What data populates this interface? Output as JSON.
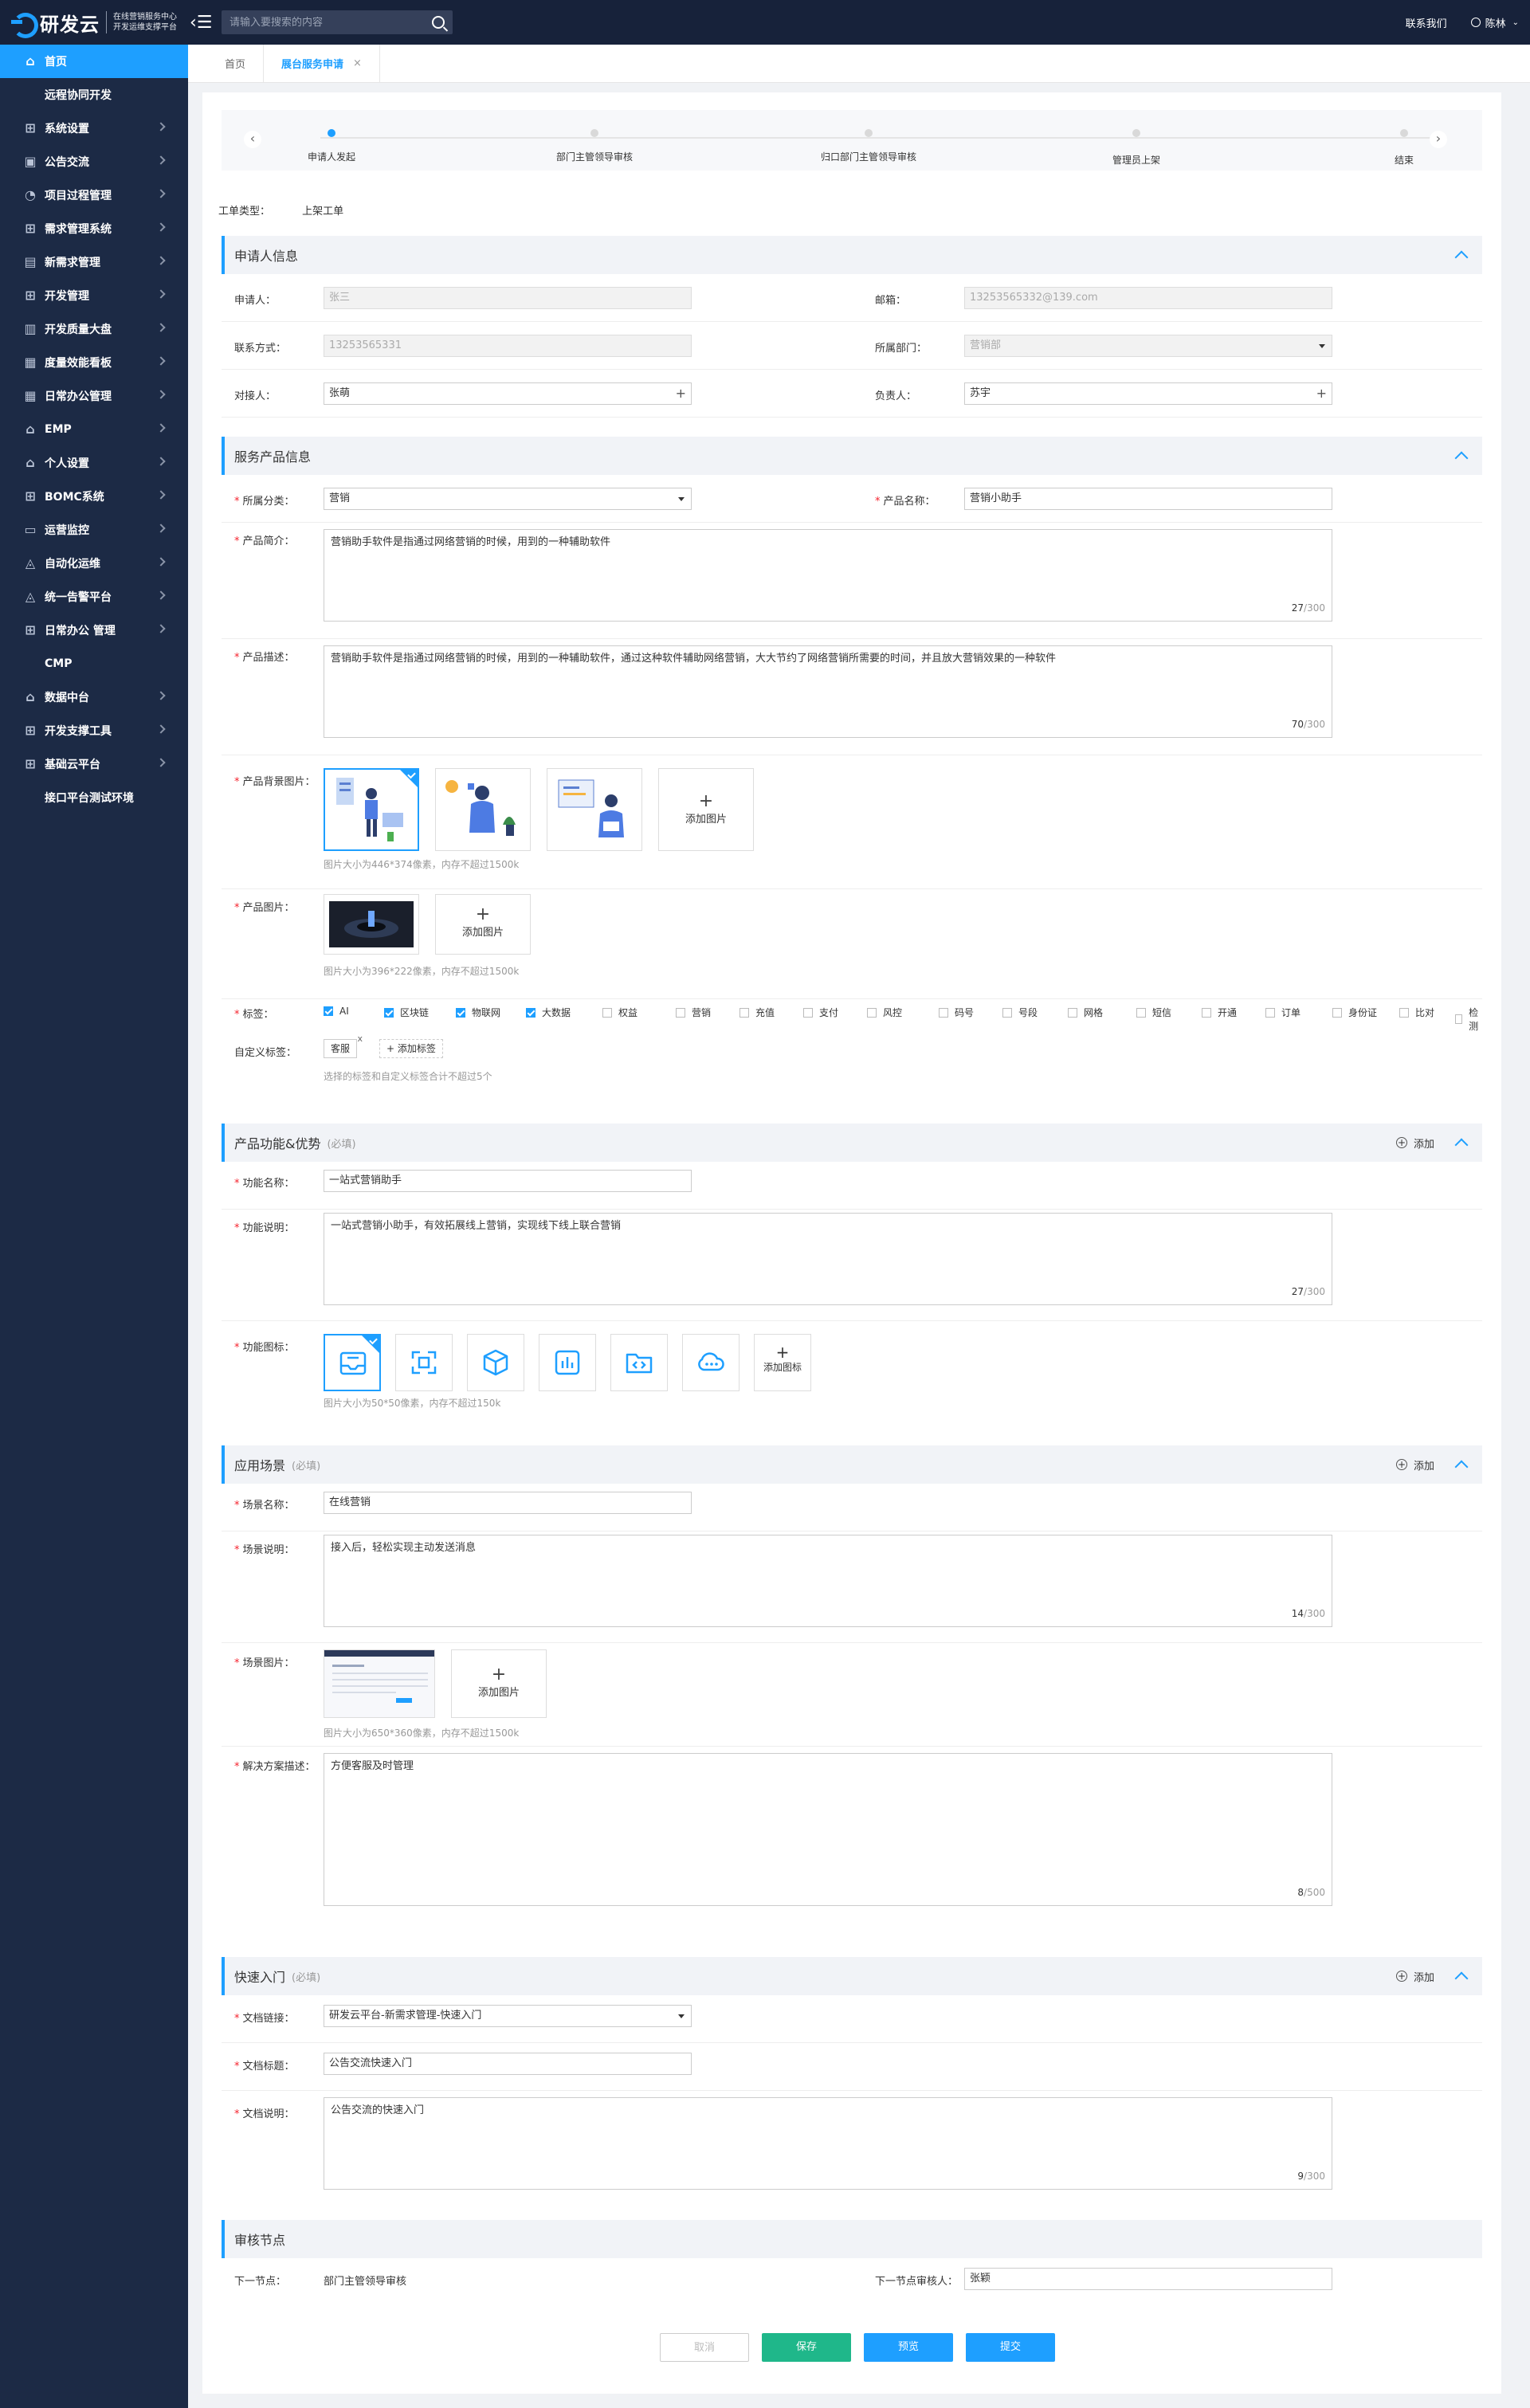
{
  "header": {
    "logo_name": "研发云",
    "logo_sub1": "在线营销服务中心",
    "logo_sub2": "开发运维支撑平台",
    "search_placeholder": "请输入要搜索的内容",
    "contact": "联系我们",
    "user": "陈林"
  },
  "sidebar": {
    "items": [
      {
        "label": "首页",
        "icon": "home-icon",
        "active": true
      },
      {
        "label": "远程协同开发",
        "child": true
      },
      {
        "label": "系统设置",
        "icon": "sitemap-icon"
      },
      {
        "label": "公告交流",
        "icon": "notice-icon"
      },
      {
        "label": "项目过程管理",
        "icon": "pie-icon"
      },
      {
        "label": "需求管理系统",
        "icon": "sitemap-icon"
      },
      {
        "label": "新需求管理",
        "icon": "requirement-icon"
      },
      {
        "label": "开发管理",
        "icon": "sitemap-icon"
      },
      {
        "label": "开发质量大盘",
        "icon": "bar-chart-icon"
      },
      {
        "label": "度量效能看板",
        "icon": "board-icon"
      },
      {
        "label": "日常办公管理",
        "icon": "calendar-icon"
      },
      {
        "label": "EMP",
        "icon": "home-icon"
      },
      {
        "label": "个人设置",
        "icon": "home-icon"
      },
      {
        "label": "BOMC系统",
        "icon": "sitemap-icon"
      },
      {
        "label": "运营监控",
        "icon": "monitor-icon"
      },
      {
        "label": "自动化运维",
        "icon": "bell-icon"
      },
      {
        "label": "统一告警平台",
        "icon": "bell-icon"
      },
      {
        "label": "日常办公 管理",
        "icon": "sitemap-icon"
      },
      {
        "label": "CMP",
        "child": true
      },
      {
        "label": "数据中台",
        "icon": "home-icon"
      },
      {
        "label": "开发支撑工具",
        "icon": "sitemap-icon"
      },
      {
        "label": "基础云平台",
        "icon": "sitemap-icon"
      },
      {
        "label": "接口平台测试环境",
        "child": true
      }
    ]
  },
  "tabs": [
    {
      "label": "首页"
    },
    {
      "label": "展台服务申请",
      "close": "×"
    }
  ],
  "steps": [
    {
      "label": "申请人发起",
      "done": true
    },
    {
      "label": "部门主管领导审核"
    },
    {
      "label": "归口部门主管领导审核"
    },
    {
      "label": "管理员上架"
    },
    {
      "label": "结束"
    }
  ],
  "order": {
    "label": "工单类型：",
    "value": "上架工单"
  },
  "applicant": {
    "title": "申请人信息",
    "name_label": "申请人：",
    "name": "张三",
    "email_label": "邮箱：",
    "email": "13253565332@139.com",
    "phone_label": "联系方式：",
    "phone": "13253565331",
    "dept_label": "所属部门：",
    "dept": "营销部",
    "contact_label": "对接人：",
    "contact": "张萌",
    "owner_label": "负责人：",
    "owner": "苏宇"
  },
  "product": {
    "title": "服务产品信息",
    "category_label": "所属分类：",
    "category": "营销",
    "name_label": "产品名称：",
    "name": "营销小助手",
    "intro_label": "产品简介：",
    "intro": "营销助手软件是指通过网络营销的时候，用到的一种辅助软件",
    "intro_count": "27",
    "intro_max": "/300",
    "desc_label": "产品描述：",
    "desc": "营销助手软件是指通过网络营销的时候，用到的一种辅助软件，通过这种软件辅助网络营销，大大节约了网络营销所需要的时间，并且放大营销效果的一种软件",
    "desc_count": "70",
    "desc_max": "/300",
    "bg_label": "产品背景图片：",
    "add_image": "添加图片",
    "bg_hint": "图片大小为446*374像素，内存不超过1500k",
    "img_label": "产品图片：",
    "img_hint": "图片大小为396*222像素，内存不超过1500k",
    "tags_label": "标签：",
    "tags": [
      {
        "t": "AI",
        "on": true
      },
      {
        "t": "区块链",
        "on": true
      },
      {
        "t": "物联网",
        "on": true
      },
      {
        "t": "大数据",
        "on": true
      },
      {
        "t": "权益"
      },
      {
        "t": "营销"
      },
      {
        "t": "充值"
      },
      {
        "t": "支付"
      },
      {
        "t": "风控"
      },
      {
        "t": "码号"
      },
      {
        "t": "号段"
      },
      {
        "t": "网格"
      },
      {
        "t": "短信"
      },
      {
        "t": "开通"
      },
      {
        "t": "订单"
      },
      {
        "t": "身份证"
      },
      {
        "t": "比对"
      },
      {
        "t": "检测"
      }
    ],
    "custom_label": "自定义标签：",
    "custom_tag": "客服",
    "add_tag": "+ 添加标签",
    "tags_hint": "选择的标签和自定义标签合计不超过5个"
  },
  "feature": {
    "title": "产品功能&优势",
    "required": "(必填)",
    "add": "添加",
    "name_label": "功能名称：",
    "name": "一站式营销助手",
    "desc_label": "功能说明：",
    "desc": "一站式营销小助手，有效拓展线上营销，实现线下线上联合营销",
    "desc_count": "27",
    "desc_max": "/300",
    "icon_label": "功能图标：",
    "add_icon": "添加图标",
    "icon_hint": "图片大小为50*50像素，内存不超过150k"
  },
  "scene": {
    "title": "应用场景",
    "required": "(必填)",
    "add": "添加",
    "name_label": "场景名称：",
    "name": "在线营销",
    "desc_label": "场景说明：",
    "desc": "接入后，轻松实现主动发送消息",
    "desc_count": "14",
    "desc_max": "/300",
    "img_label": "场景图片：",
    "add_image": "添加图片",
    "img_hint": "图片大小为650*360像素，内存不超过1500k",
    "solution_label": "解决方案描述：",
    "solution": "方便客服及时管理",
    "solution_count": "8",
    "solution_max": "/500"
  },
  "quick": {
    "title": "快速入门",
    "required": "(必填)",
    "add": "添加",
    "link_label": "文档链接：",
    "link": "研发云平台-新需求管理-快速入门",
    "title_label": "文档标题：",
    "doc_title": "公告交流快速入门",
    "desc_label": "文档说明：",
    "desc": "公告交流的快速入门",
    "desc_count": "9",
    "desc_max": "/300"
  },
  "review": {
    "title": "审核节点",
    "next_label": "下一节点：",
    "next": "部门主管领导审核",
    "reviewer_label": "下一节点审核人：",
    "reviewer": "张颖"
  },
  "buttons": {
    "cancel": "取消",
    "save": "保存",
    "preview": "预览",
    "submit": "提交"
  },
  "colors": {
    "accent": "#1e9fff",
    "save": "#1fb78a",
    "topbar": "#17223a",
    "sidebar": "#1c2a45"
  }
}
